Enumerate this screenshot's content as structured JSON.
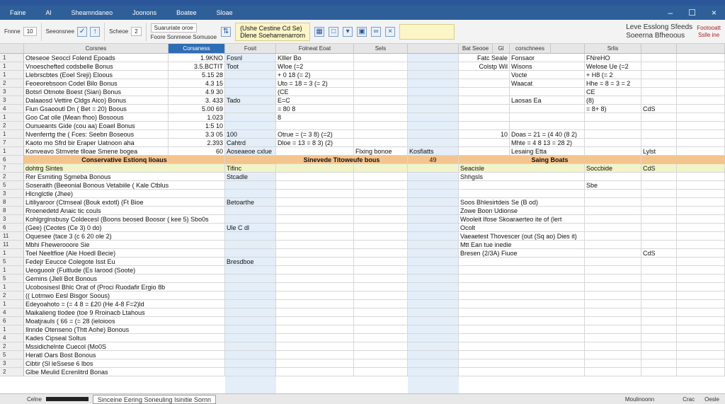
{
  "title_tabs": [
    "Faine",
    "Al",
    "Sheamndaneo",
    "Joonons",
    "Boatee",
    "Sloae"
  ],
  "ribbon": {
    "grp1_label": "Fnnne",
    "grp2_label": "Seeonsnee",
    "grp3_label": "Scheoe",
    "grp4_label": "Suaruriate oroe",
    "grp4_sub": "Foore Sonmeoe Somusoe",
    "highlight_title": "(Ushe Cestine Cd Se)",
    "highlight_sub": "Dlene Soeharrenarrorn",
    "right_title": "Leve Esslong Sfeeds",
    "right_sub": "Soeerna Bfheoous",
    "right_badge1": "Footooatt",
    "right_badge2": "Sslle ine"
  },
  "columns": [
    "",
    "Corsnes",
    "Corsaness",
    "Fosit",
    "Folneat Eoat",
    "Sels",
    "",
    "Bat Seooe",
    "Gl",
    "corschnees",
    "",
    "Srlis",
    "",
    ""
  ],
  "rows": [
    [
      "1",
      "Oteseoe Seoccl Folend Epoads",
      "1.9KNO",
      "Fosnl",
      "Klller Bo",
      "",
      "",
      "Fatc Seale",
      "Fonsaor",
      "FNreHO",
      "",
      "",
      ""
    ],
    [
      "1",
      "Vnoeschefted codsbelle Bonus",
      "3.5.BCTIT",
      "Toot",
      "Wloe (=2",
      "",
      "",
      "Colstp Wil",
      "Wisons",
      "Welose Ue (=2",
      "",
      "",
      ""
    ],
    [
      "1",
      "Llebrscbtes (Eoel Sreji) Eloous",
      "5.15 28",
      "",
      "+ 0 18 (= 2)",
      "",
      "",
      "",
      "Vocte",
      "+ H8 (= 2",
      "",
      "",
      ""
    ],
    [
      "2",
      "Feoeorebsoon Codel Bilo Bonus",
      "4.3 15",
      "",
      "Uto = 18 = 3 (= 2)",
      "",
      "",
      "",
      "Waacat",
      "Hhe = 8 = 3 = 2",
      "",
      "",
      ""
    ],
    [
      "3",
      "Botsrl Otmote Boest (Sian) Bonus",
      "4.9 30",
      "",
      "(CE",
      "",
      "",
      "",
      "",
      "CE",
      "",
      "",
      ""
    ],
    [
      "3",
      "Dalaaosd Vettire Cldgs Aico) Bonus",
      "3. 433",
      "Tado",
      "E=C",
      "",
      "",
      "",
      "Laosas Ea",
      "(8)",
      "",
      "",
      ""
    ],
    [
      "4",
      "Fiun Gsaooutl Dn ( Bet = 20) Boous",
      "5.00 69",
      "",
      "= 80 8",
      "",
      "",
      "",
      "",
      "= 8+ 8)",
      "CdS",
      "",
      ""
    ],
    [
      "1",
      "Goo Cat olle (Mean fhoo) Bosoous",
      "1.023",
      "",
      "8",
      "",
      "",
      "",
      "",
      "",
      "",
      "",
      ""
    ],
    [
      "2",
      "Ounueants Gide (cou aa) Eoael Bonus",
      "1:5 10",
      "",
      "",
      "",
      "",
      "",
      "",
      "",
      "",
      "",
      ""
    ],
    [
      "1",
      "Nvenferrtg the ( Fces: Seebn Boseous",
      "3.3 05",
      "100",
      "Otrue = (= 3 8) (=2)",
      "",
      "",
      "10",
      "Doas = 21 = (4 40 (8 2)",
      "",
      "",
      "",
      ""
    ],
    [
      "7",
      "Kaoto mo Sfrd bir Eraper Uatnoon aha",
      "2.393",
      "Cahtrd",
      "Dloe = 13 = 8 3) (2)",
      "",
      "",
      "",
      "Mhte = 4 8 13 = 28 2)",
      "",
      "",
      "",
      ""
    ],
    [
      "1",
      "Konveavo Stmvete tlloae Smene bogea",
      "60",
      "Aoseaeoe cxlue",
      "",
      "Flxing bonoe",
      "Kosfiatts",
      "",
      "Lesaing Etta",
      "",
      "Lylst",
      "",
      ""
    ]
  ],
  "section": {
    "row": "6",
    "left": "Conservative Estionq lioaus",
    "mid": "Sinevede Titoweufe bous",
    "num": "49",
    "right": "Saing Boats"
  },
  "rows2": [
    [
      "7",
      "dohtrg Sintes",
      "Tifinc",
      "",
      "",
      "",
      "Seacisle",
      "Soccbide",
      "CdS"
    ],
    [
      "2",
      "Rer Esmiting Sgmeba Bonous",
      "Stcadle",
      "",
      "",
      "",
      "Shhgsls",
      "",
      ""
    ],
    [
      "5",
      "Soseraith (Beeonial Bonous Vetabiile ( Kale Ctblus",
      "",
      "",
      "",
      "",
      "",
      "Sbe",
      "",
      ""
    ],
    [
      "3",
      "Hlcnglctle (Jhee)",
      "",
      "",
      "",
      "",
      "",
      "",
      "",
      ""
    ],
    [
      "8",
      "Litiliyaroor (Ctmseal (Bouk extotl) (Ft Bioe",
      "Betoarthe",
      "",
      "",
      "",
      "Soos Bhlesirtdeis Se (B od)",
      "",
      "",
      ""
    ],
    [
      "8",
      "Rroenedetd Anaic tic couls",
      "",
      "",
      "",
      "",
      "Zowe Boon Udionse",
      "",
      "",
      ""
    ],
    [
      "3",
      "Kohlgrglnsbusy Coldecesl (Boons beosed Boosor ( kee 5) Sbo0s",
      "",
      "",
      "",
      "",
      "Wooleit Ifose Skoaraerteo ite of (lert",
      "",
      "",
      ""
    ],
    [
      "6",
      "(Gee) (Ceotes (Ce 3) 0 do)",
      "Ule C dl",
      "",
      "",
      "",
      "Ocolt",
      "",
      "",
      ""
    ],
    [
      "11",
      "Oquesee (tace 3 (c 6 20 ole 2)",
      "",
      "",
      "",
      "",
      "Vaeaetest Thovescer (out (Sq ao) Dies it)",
      "",
      "",
      ""
    ],
    [
      "11",
      "Mbhi Fhewerooore Sie",
      "",
      "",
      "",
      "",
      "Mtt Ean tue inedie",
      "",
      "",
      ""
    ],
    [
      "1",
      "Toel Neeltfioe (Ale Hoedl Becie)",
      "",
      "",
      "",
      "",
      "Bresen (2/3A) Fiuoe",
      "",
      "CdS",
      ""
    ],
    [
      "5",
      "Fedejr Eeucce Colegote Isst Eu",
      "Bresdboe",
      "",
      "",
      "",
      "",
      "",
      "",
      ""
    ],
    [
      "1",
      "Ueoguoolr (Fuitlude (Es Iarood (Soote)",
      "",
      "",
      "",
      "",
      "",
      "",
      "",
      ""
    ],
    [
      "5",
      "Gemins (Jlell Bot Bonous",
      "",
      "",
      "",
      "",
      "",
      "",
      "",
      ""
    ],
    [
      "1",
      "Ucobosisesl Bhlc Orat of (Proci Ruodafir Ergio 8b",
      "",
      "",
      "",
      "",
      "",
      "",
      "",
      ""
    ],
    [
      "2",
      "(( Lotmwo Eesl Bisgor Soous)",
      "",
      "",
      "",
      "",
      "",
      "",
      "",
      ""
    ],
    [
      "1",
      "Edeyoahoto = (= 4 8 = £20 (He 4-8 F=2)ld",
      "",
      "",
      "",
      "",
      "",
      "",
      "",
      ""
    ],
    [
      "4",
      "Maikalieng tlodee (toe 9 Rroinacb Ltahous",
      "",
      "",
      "",
      "",
      "",
      "",
      "",
      ""
    ],
    [
      "6",
      "Moatjrauls ( 66 = (= 28 (ieloioos",
      "",
      "",
      "",
      "",
      "",
      "",
      "",
      ""
    ],
    [
      "1",
      "Ilnnde Otenseno (Thtt Aohe) Bonous",
      "",
      "",
      "",
      "",
      "",
      "",
      "",
      ""
    ],
    [
      "4",
      "Kades Cipseal Soltus",
      "",
      "",
      "",
      "",
      "",
      "",
      "",
      ""
    ],
    [
      "2",
      "Mssidichelnte Cuecol (Mo0S",
      "",
      "",
      "",
      "",
      "",
      "",
      "",
      ""
    ],
    [
      "5",
      "Heratl Oars Bost Bonous",
      "",
      "",
      "",
      "",
      "",
      "",
      "",
      ""
    ],
    [
      "3",
      "Cibtir (Sl leSsese 6 lbos",
      "",
      "",
      "",
      "",
      "",
      "",
      "",
      ""
    ],
    [
      "2",
      "Glbe Meulid Ecrenlitrd Bonas",
      "",
      "",
      "",
      "",
      "",
      "",
      "",
      ""
    ]
  ],
  "sheetbar": {
    "left": "Celne",
    "tab": "Sinceine Eering Soneuling Isinitie Sornn",
    "right1": "Moulinoonn",
    "right2": "Crac",
    "right3": "Oesle"
  }
}
